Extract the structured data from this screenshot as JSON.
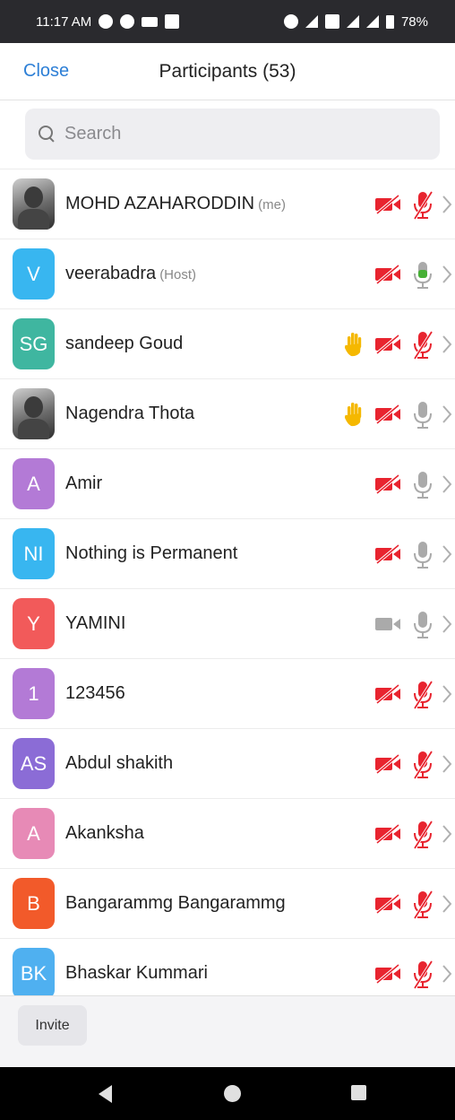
{
  "status_bar": {
    "time": "11:17 AM",
    "battery": "78%",
    "left_icons": [
      "whatsapp-icon",
      "phone-icon",
      "video-icon",
      "gallery-icon"
    ],
    "right_icons": [
      "alarm-icon",
      "data-arrows-icon",
      "wifi-icon",
      "volte-icon",
      "hotspot-icon",
      "signal-icon",
      "signal-icon",
      "battery-icon"
    ]
  },
  "header": {
    "close_label": "Close",
    "title": "Participants (53)"
  },
  "search": {
    "placeholder": "Search"
  },
  "colors": {
    "accent_blue": "#2d7fd6",
    "muted_red": "#e8242f",
    "unmuted_green": "#46b035",
    "neutral_gray": "#aaaaaa",
    "raised_hand": "#f5b800"
  },
  "participants": [
    {
      "initials": "",
      "avatar_type": "photo",
      "avatar_color": "",
      "name": "MOHD AZAHARODDIN",
      "tag": "(me)",
      "hand": false,
      "video": "off",
      "audio": "muted"
    },
    {
      "initials": "V",
      "avatar_type": "initials",
      "avatar_color": "#38b6f0",
      "name": "veerabadra",
      "tag": "(Host)",
      "hand": false,
      "video": "off",
      "audio": "unmuted"
    },
    {
      "initials": "SG",
      "avatar_type": "initials",
      "avatar_color": "#3fb6a0",
      "name": "sandeep Goud",
      "tag": "",
      "hand": true,
      "video": "off",
      "audio": "muted"
    },
    {
      "initials": "",
      "avatar_type": "photo",
      "avatar_color": "",
      "name": "Nagendra Thota",
      "tag": "",
      "hand": true,
      "video": "off",
      "audio": "none"
    },
    {
      "initials": "A",
      "avatar_type": "initials",
      "avatar_color": "#b37ad6",
      "name": "Amir",
      "tag": "",
      "hand": false,
      "video": "off",
      "audio": "none"
    },
    {
      "initials": "NI",
      "avatar_type": "initials",
      "avatar_color": "#38b6f0",
      "name": "Nothing is Permanent",
      "tag": "",
      "hand": false,
      "video": "off",
      "audio": "none"
    },
    {
      "initials": "Y",
      "avatar_type": "initials",
      "avatar_color": "#f25a5a",
      "name": "YAMINI",
      "tag": "",
      "hand": false,
      "video": "none",
      "audio": "none"
    },
    {
      "initials": "1",
      "avatar_type": "initials",
      "avatar_color": "#b37ad6",
      "name": "123456",
      "tag": "",
      "hand": false,
      "video": "off",
      "audio": "muted"
    },
    {
      "initials": "AS",
      "avatar_type": "initials",
      "avatar_color": "#8b6cd6",
      "name": "Abdul shakith",
      "tag": "",
      "hand": false,
      "video": "off",
      "audio": "muted"
    },
    {
      "initials": "A",
      "avatar_type": "initials",
      "avatar_color": "#e78ab6",
      "name": "Akanksha",
      "tag": "",
      "hand": false,
      "video": "off",
      "audio": "muted"
    },
    {
      "initials": "B",
      "avatar_type": "initials",
      "avatar_color": "#f25a2a",
      "name": "Bangarammg Bangarammg",
      "tag": "",
      "hand": false,
      "video": "off",
      "audio": "muted"
    },
    {
      "initials": "BK",
      "avatar_type": "initials",
      "avatar_color": "#4fb0f0",
      "name": "Bhaskar Kummari",
      "tag": "",
      "hand": false,
      "video": "off",
      "audio": "muted"
    }
  ],
  "footer": {
    "invite_label": "Invite"
  },
  "nav_bar": {
    "icons": [
      "back-icon",
      "home-icon",
      "recents-icon"
    ]
  }
}
